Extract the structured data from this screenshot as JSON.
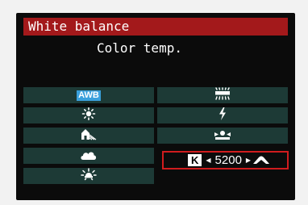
{
  "title": "White balance",
  "current_setting": "Color temp.",
  "options": {
    "awb": {
      "label": "AWB",
      "icon": "awb-icon"
    },
    "daylight": {
      "icon": "daylight-sun-icon"
    },
    "shade": {
      "icon": "shade-house-icon"
    },
    "cloudy": {
      "icon": "cloudy-icon"
    },
    "tungsten": {
      "icon": "tungsten-bulb-icon"
    },
    "fluorescent": {
      "icon": "fluorescent-icon"
    },
    "flash": {
      "icon": "flash-icon"
    },
    "custom": {
      "icon": "custom-wb-icon"
    }
  },
  "color_temp": {
    "k_label": "K",
    "left_arrow": "◀",
    "value": "5200",
    "right_arrow": "▶",
    "icon": "cloud-mountain-icon"
  },
  "colors": {
    "title_bar": "#a3191b",
    "cell_bg": "#1d3a36",
    "selection_border": "#d01c1e",
    "awb_badge": "#3aa0dc"
  }
}
